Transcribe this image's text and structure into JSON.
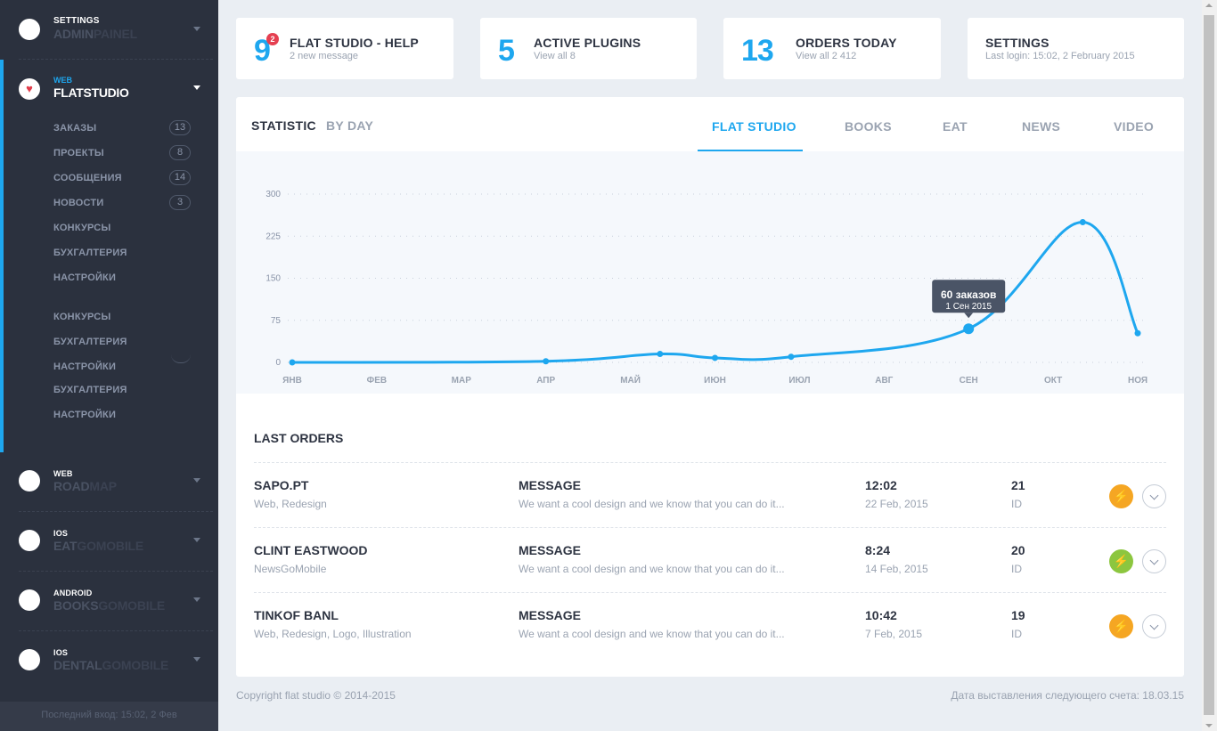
{
  "sidebar": {
    "groups": [
      {
        "small": "SETTINGS",
        "big_a": "ADMIN",
        "big_b": "PAINEL"
      },
      {
        "small": "WEB",
        "big_a": "ROAD",
        "big_b": "MAP"
      },
      {
        "small": "IOS",
        "big_a": "EAT",
        "big_b": "GOMOBILE"
      },
      {
        "small": "ANDROID",
        "big_a": "BOOKS",
        "big_b": "GOMOBILE"
      },
      {
        "small": "IOS",
        "big_a": "DENTAL",
        "big_b": "GOMOBILE"
      }
    ],
    "active": {
      "small": "WEB",
      "big": "FLATSTUDIO",
      "items": [
        {
          "label": "ЗАКАЗЫ",
          "count": "13"
        },
        {
          "label": "ПРОЕКТЫ",
          "count": "8"
        },
        {
          "label": "СООБЩЕНИЯ",
          "count": "14"
        },
        {
          "label": "НОВОСТИ",
          "count": "3"
        },
        {
          "label": "КОНКУРСЫ",
          "count": ""
        },
        {
          "label": "БУХГАЛТЕРИЯ",
          "count": ""
        },
        {
          "label": "НАСТРОЙКИ",
          "count": ""
        },
        {
          "label": "КОНКУРСЫ",
          "count": ""
        },
        {
          "label": "БУХГАЛТЕРИЯ",
          "count": ""
        },
        {
          "label": "НАСТРОЙКИ",
          "count": ""
        },
        {
          "label": "БУХГАЛТЕРИЯ",
          "count": ""
        },
        {
          "label": "НАСТРОЙКИ",
          "count": ""
        }
      ]
    },
    "footer": "Последний вход: 15:02, 2 Фев"
  },
  "top_cards": [
    {
      "num": "9",
      "badge": "2",
      "title": "FLAT STUDIO - HELP",
      "sub": "2 new message"
    },
    {
      "num": "5",
      "title": "ACTIVE PLUGINS",
      "sub": "View all 8"
    },
    {
      "num": "13",
      "title": "ORDERS TODAY",
      "sub": "View all 2 412"
    },
    {
      "title": "SETTINGS",
      "sub": "Last login: 15:02, 2 February 2015"
    }
  ],
  "statistic": {
    "label": "STATISTIC",
    "mode": "BY DAY",
    "tabs": [
      "FLAT STUDIO",
      "BOOKS",
      "EAT",
      "NEWS",
      "VIDEO"
    ],
    "active_tab": "FLAT STUDIO"
  },
  "chart_data": {
    "type": "line",
    "categories": [
      "ЯНВ",
      "ФЕВ",
      "МАР",
      "АПР",
      "МАЙ",
      "ИЮН",
      "ИЮЛ",
      "АВГ",
      "СЕН",
      "ОКТ",
      "НОЯ"
    ],
    "points": [
      {
        "x": 0.0,
        "y": 0
      },
      {
        "x": 3.0,
        "y": 2
      },
      {
        "x": 4.35,
        "y": 15
      },
      {
        "x": 5.0,
        "y": 8
      },
      {
        "x": 5.9,
        "y": 10
      },
      {
        "x": 8.0,
        "y": 60
      },
      {
        "x": 9.35,
        "y": 250
      },
      {
        "x": 10.0,
        "y": 52
      }
    ],
    "y_ticks": [
      "300",
      "225",
      "150",
      "75",
      "0"
    ],
    "ylim": [
      0,
      300
    ],
    "grid": true,
    "color": "#1ea7ef",
    "tooltip": {
      "title": "60 заказов",
      "sub": "1 Сен 2015"
    }
  },
  "orders": {
    "title": "LAST ORDERS",
    "rows": [
      {
        "name": "SAPO.PT",
        "tags": "Web, Redesign",
        "msg_head": "MESSAGE",
        "msg": "We want a cool design and we know that you can do it...",
        "time": "12:02",
        "date": "22 Feb, 2015",
        "id": "21",
        "id_label": "ID",
        "status_color": "#f5a623"
      },
      {
        "name": "CLINT EASTWOOD",
        "tags": "NewsGoMobile",
        "msg_head": "MESSAGE",
        "msg": "We want a cool design and we know that you can do it...",
        "time": "8:24",
        "date": "14 Feb, 2015",
        "id": "20",
        "id_label": "ID",
        "status_color": "#8cc63f"
      },
      {
        "name": "TINKOF BANL",
        "tags": "Web, Redesign, Logo, Illustration",
        "msg_head": "MESSAGE",
        "msg": "We want a cool design and we know that you can do it...",
        "time": "10:42",
        "date": "7 Feb, 2015",
        "id": "19",
        "id_label": "ID",
        "status_color": "#f5a623"
      }
    ]
  },
  "footer": {
    "copyright": "Copyright flat studio © 2014-2015",
    "billing": "Дата выставления следующего счета: 18.03.15"
  },
  "colors": {
    "accent": "#1ea7ef",
    "sidebar_bg": "#2b313e",
    "page_bg": "#eaeef3"
  }
}
